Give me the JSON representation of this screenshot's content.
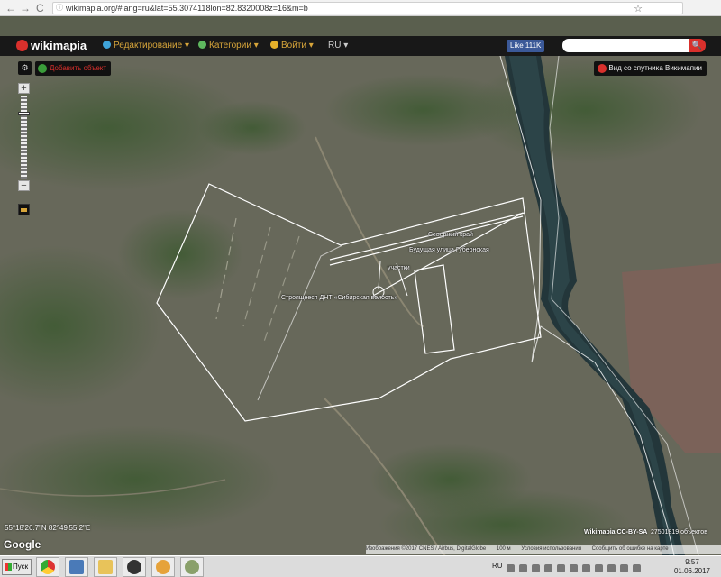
{
  "browser": {
    "back": "←",
    "forward": "→",
    "reload": "C",
    "url": "wikimapia.org/#lang=ru&lat=55.3074118lon=82.8320008z=16&m=b",
    "star": "☆"
  },
  "header": {
    "logo": "wikimapia",
    "menu": [
      {
        "label": "Редактирование ▾",
        "color": "#3fa3d9"
      },
      {
        "label": "Категории ▾",
        "color": "#5fb85f"
      },
      {
        "label": "Войти ▾",
        "color": "#e5b02a"
      }
    ],
    "language": "RU ▾",
    "like": "Like 111K",
    "search_button": "🔍"
  },
  "map": {
    "settings_icon": "⚙",
    "add_object": "Добавить объект",
    "zoom_in": "+",
    "zoom_out": "−",
    "satellite_view": "Вид со спутника Викимапии",
    "labels": [
      "Северный край",
      "Будущая улица Губернская",
      "участки",
      "Строящееся ДНТ «Сибирская волость»"
    ],
    "coordinates": "55°18'26.7\"N 82°49'55.2\"E",
    "google": "Google",
    "attribution": "Wikimapia CC-BY-SA",
    "object_count": "27501819 объектов",
    "footer_items": [
      "Изображения ©2017 CNES / Airbus, DigitalGlobe",
      "100 м",
      "Условия использования",
      "Сообщить об ошибке на карте"
    ]
  },
  "taskbar": {
    "start": "Пуск",
    "language": "RU",
    "time": "9:57",
    "date": "01.06.2017"
  }
}
